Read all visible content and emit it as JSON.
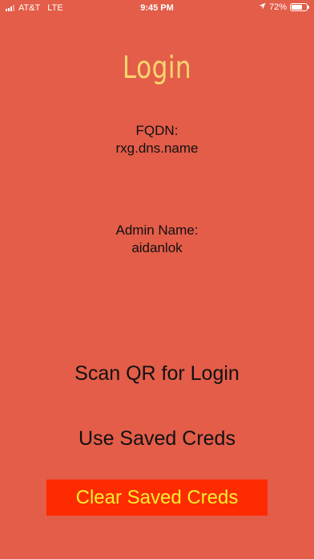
{
  "status_bar": {
    "carrier": "AT&T",
    "network": "LTE",
    "time": "9:45 PM",
    "battery_percent": "72%",
    "battery_level": 0.72,
    "location_icon": "location-arrow-icon"
  },
  "screen": {
    "title": "Login",
    "fqdn_label": "FQDN:",
    "fqdn_value": "rxg.dns.name",
    "admin_label": "Admin Name:",
    "admin_value": "aidanlok"
  },
  "actions": {
    "scan_qr": "Scan QR for Login",
    "use_saved": "Use Saved Creds",
    "clear_saved": "Clear Saved Creds"
  },
  "colors": {
    "background": "#E35D49",
    "title": "#F7D56E",
    "clear_button_bg": "#FE2A00",
    "clear_button_text": "#F5F02A"
  }
}
